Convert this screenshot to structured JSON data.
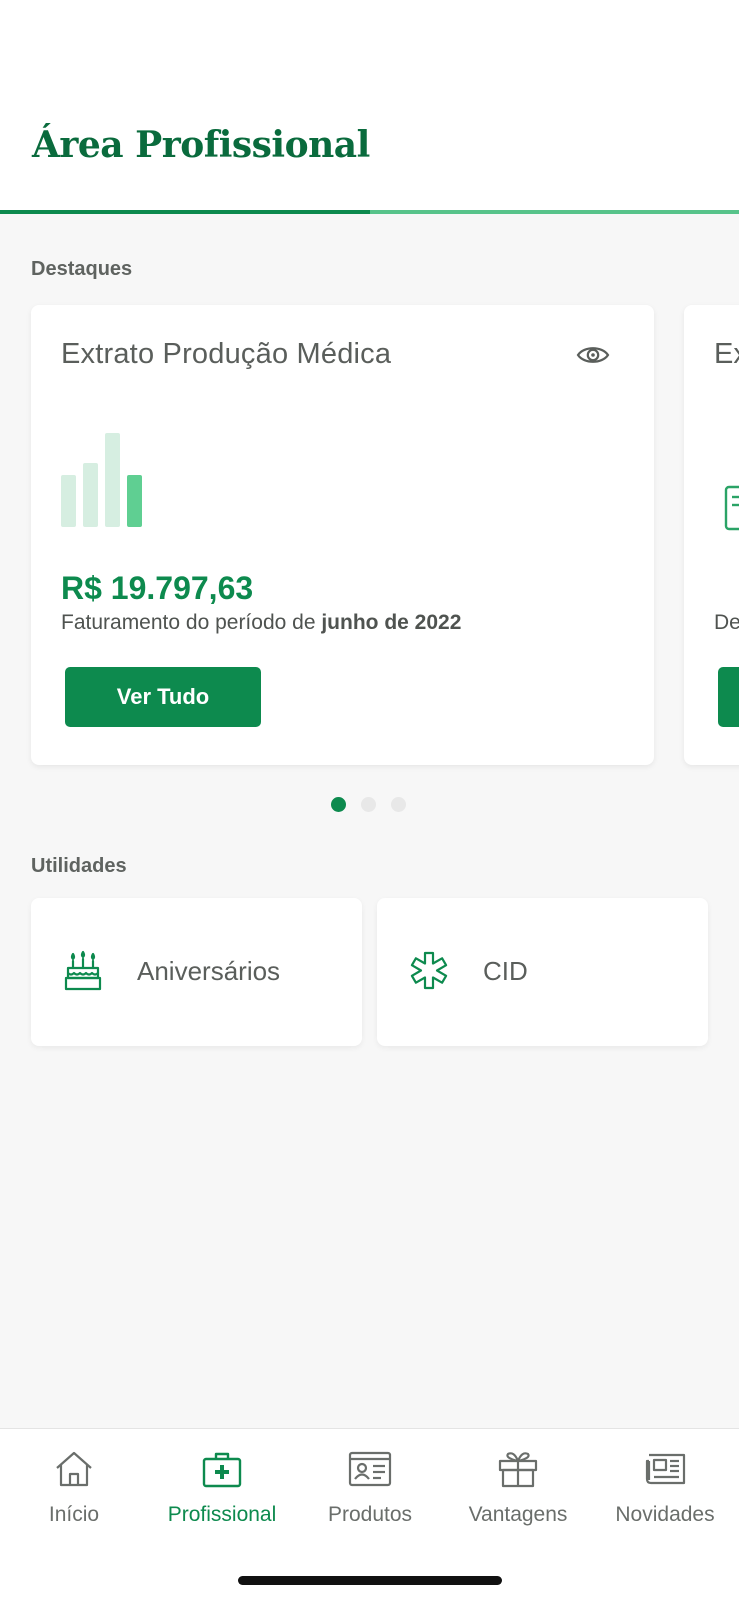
{
  "header": {
    "title": "Área Profissional",
    "progress_fraction": 0.5
  },
  "highlights": {
    "section_label": "Destaques",
    "cards": [
      {
        "title": "Extrato Produção Médica",
        "amount": "R$ 19.797,63",
        "period_prefix": "Faturamento do período de ",
        "period_value": "junho de 2022",
        "button_label": "Ver Tudo",
        "bar_levels": [
          0.5,
          0.62,
          0.9,
          0.5
        ]
      },
      {
        "title": "Ex",
        "text": "De"
      }
    ],
    "pagination": {
      "count": 3,
      "active_index": 0
    }
  },
  "utilities": {
    "section_label": "Utilidades",
    "items": [
      {
        "label": "Aniversários",
        "icon": "birthday-cake-icon"
      },
      {
        "label": "CID",
        "icon": "medical-asterisk-icon"
      }
    ]
  },
  "bottom_nav": {
    "items": [
      {
        "label": "Início",
        "icon": "home-icon",
        "active": false
      },
      {
        "label": "Profissional",
        "icon": "medical-kit-icon",
        "active": true
      },
      {
        "label": "Produtos",
        "icon": "id-card-icon",
        "active": false
      },
      {
        "label": "Vantagens",
        "icon": "gift-icon",
        "active": false
      },
      {
        "label": "Novidades",
        "icon": "newspaper-icon",
        "active": false
      }
    ]
  },
  "colors": {
    "primary": "#0d8a4e",
    "title_green": "#0a6b3d",
    "bar_light": "#d6eee1",
    "bar_accent": "#5fcf92"
  }
}
